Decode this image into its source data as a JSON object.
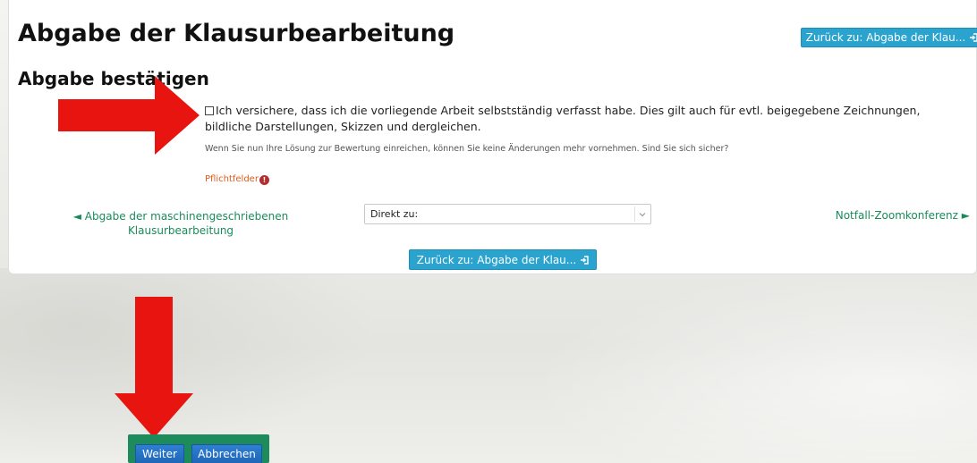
{
  "header": {
    "title": "Abgabe der Klausurbearbeitung",
    "back_button_label": "Zurück zu: Abgabe der Klau..."
  },
  "form": {
    "section_title": "Abgabe bestätigen",
    "confirmation_text": "Ich versichere, dass ich die vorliegende Arbeit selbstständig verfasst habe. Dies gilt auch für evtl. beigegebene Zeichnungen, bildliche Darstellungen, Skizzen und dergleichen.",
    "confirmation_checked": false,
    "warning_text": "Wenn Sie nun Ihre Lösung zur Bewertung einreichen, können Sie keine Änderungen mehr vornehmen. Sind Sie sich sicher?",
    "required_label": "Pflichtfelder",
    "required_icon": "!"
  },
  "navigation": {
    "prev_label": "◄ Abgabe der maschinengeschriebenen Klausurbearbeitung",
    "jump_select_value": "Direkt zu:",
    "next_label": "Notfall-Zoomkonferenz ►"
  },
  "footer": {
    "back_button_label": "Zurück zu: Abgabe der Klau..."
  },
  "actions": {
    "continue_label": "Weiter",
    "cancel_label": "Abbrechen"
  },
  "colors": {
    "accent_button": "#2aa3cf",
    "link_green": "#1a8a5b",
    "required_orange": "#e05a1b",
    "annotation_red": "#e8140f",
    "action_bar_green": "#1e8b5d",
    "action_button_blue": "#2f7fd3"
  },
  "icons": {
    "back_button_icon": "sign-in-icon",
    "required_icon": "exclamation-circle-icon",
    "select_icon": "chevron-down-icon",
    "annotation_right": "red-arrow-right-icon",
    "annotation_down": "red-arrow-down-icon"
  }
}
